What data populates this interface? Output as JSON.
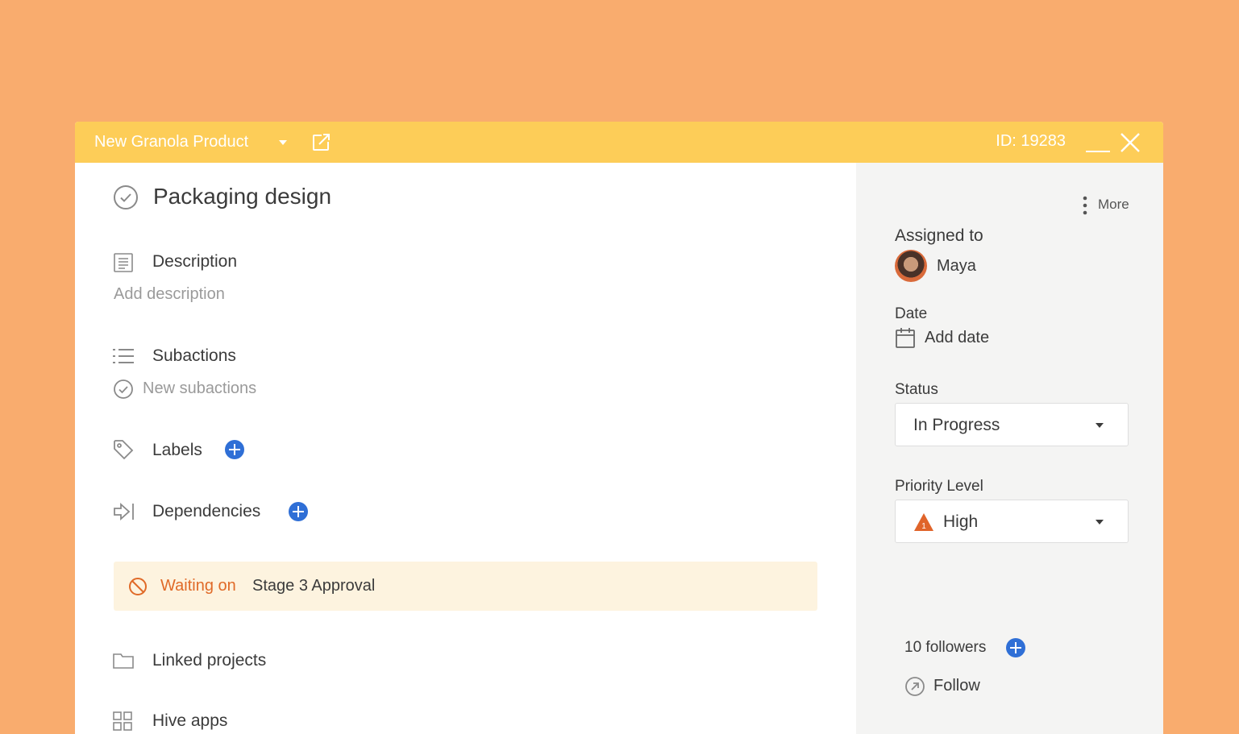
{
  "header": {
    "project_name": "New Granola Product",
    "task_id": "ID: 19283"
  },
  "task": {
    "title": "Packaging design",
    "description_label": "Description",
    "description_placeholder": "Add description",
    "subactions_label": "Subactions",
    "subactions_placeholder": "New subactions",
    "labels_label": "Labels",
    "dependencies_label": "Dependencies",
    "waiting_prefix": "Waiting on",
    "waiting_target": "Stage 3 Approval",
    "linked_projects_label": "Linked projects",
    "hive_apps_label": "Hive apps"
  },
  "sidebar": {
    "more_label": "More",
    "assigned_label": "Assigned to",
    "assignee_name": "Maya",
    "date_label": "Date",
    "date_placeholder": "Add date",
    "status_label": "Status",
    "status_value": "In Progress",
    "priority_label": "Priority Level",
    "priority_value": "High",
    "priority_badge": "1",
    "followers_label": "10 followers",
    "follow_label": "Follow"
  },
  "colors": {
    "background": "#f9ac6e",
    "header": "#fdcd58",
    "accent_blue": "#2f6fd6",
    "waiting_orange": "#e06a28",
    "waiting_bg": "#fdf3df",
    "sidebar_bg": "#f4f4f3"
  },
  "icons": [
    "caret-down-icon",
    "open-external-icon",
    "minimize-icon",
    "close-icon",
    "check-circle-icon",
    "description-icon",
    "list-icon",
    "tag-icon",
    "arrow-dependency-icon",
    "plus-icon",
    "blocked-icon",
    "folder-icon",
    "apps-grid-icon",
    "more-vertical-icon",
    "calendar-icon",
    "priority-warning-icon",
    "follow-icon"
  ]
}
